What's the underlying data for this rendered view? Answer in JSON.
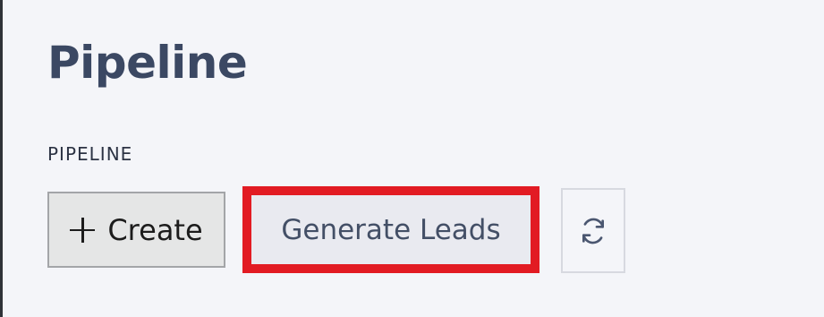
{
  "page": {
    "title": "Pipeline",
    "section_label": "PIPELINE"
  },
  "toolbar": {
    "create_label": "Create",
    "create_icon": "plus-icon",
    "generate_leads_label": "Generate Leads",
    "refresh_icon": "refresh-icon"
  },
  "colors": {
    "background": "#f4f5f9",
    "title": "#3b4863",
    "highlight": "#e21b23",
    "button_text": "#434f66"
  }
}
